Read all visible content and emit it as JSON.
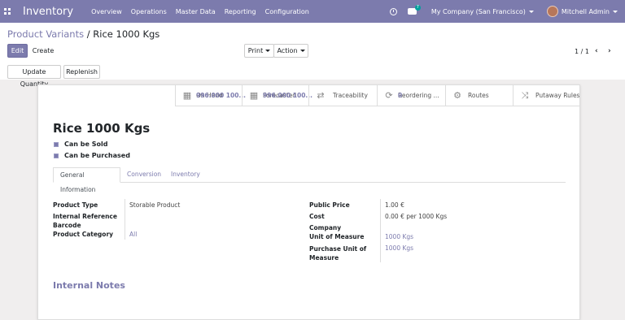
{
  "navbar": {
    "brand": "Inventory",
    "menu": [
      "Overview",
      "Operations",
      "Master Data",
      "Reporting",
      "Configuration"
    ],
    "chat_badge": "7",
    "company": "My Company (San Francisco)",
    "user": "Mitchell Admin"
  },
  "breadcrumb": {
    "parent": "Product Variants",
    "separator": " / ",
    "current": "Rice 1000 Kgs"
  },
  "buttons": {
    "edit": "Edit",
    "create": "Create",
    "print": "Print",
    "action": "Action",
    "update_quantity": "Update Quantity",
    "replenish": "Replenish"
  },
  "pager": {
    "value": "1 / 1"
  },
  "smart_buttons": [
    {
      "value": "996.000 100...",
      "label": "On Hand",
      "icon": "cubes-icon"
    },
    {
      "value": "996.000 100...",
      "label": "Forecasted",
      "icon": "cubes-icon"
    },
    {
      "value": "",
      "label": "Traceability",
      "icon": "arrows-exchange-icon"
    },
    {
      "value": "0",
      "label": "Reordering ...",
      "icon": "refresh-icon"
    },
    {
      "value": "",
      "label": "Routes",
      "icon": "cogs-icon"
    },
    {
      "value": "",
      "label": "Putaway Rules",
      "icon": "random-icon"
    }
  ],
  "product": {
    "name": "Rice 1000 Kgs",
    "can_be_sold": "Can be Sold",
    "can_be_purchased": "Can be Purchased"
  },
  "tabs": [
    "General Information",
    "Conversion",
    "Inventory"
  ],
  "left_fields": {
    "product_type_label": "Product Type",
    "product_type_value": "Storable Product",
    "internal_reference_label": "Internal Reference",
    "barcode_label": "Barcode",
    "product_category_label": "Product Category",
    "product_category_value": "All"
  },
  "right_fields": {
    "public_price_label": "Public Price",
    "public_price_value": "1.00 €",
    "cost_label": "Cost",
    "cost_value": "0.00 € per 1000 Kgs",
    "company_label": "Company",
    "uom_label": "Unit of Measure",
    "uom_value": "1000 Kgs",
    "purchase_uom_label_1": "Purchase Unit of",
    "purchase_uom_label_2": "Measure",
    "purchase_uom_value": "1000 Kgs"
  },
  "notes_title": "Internal Notes"
}
